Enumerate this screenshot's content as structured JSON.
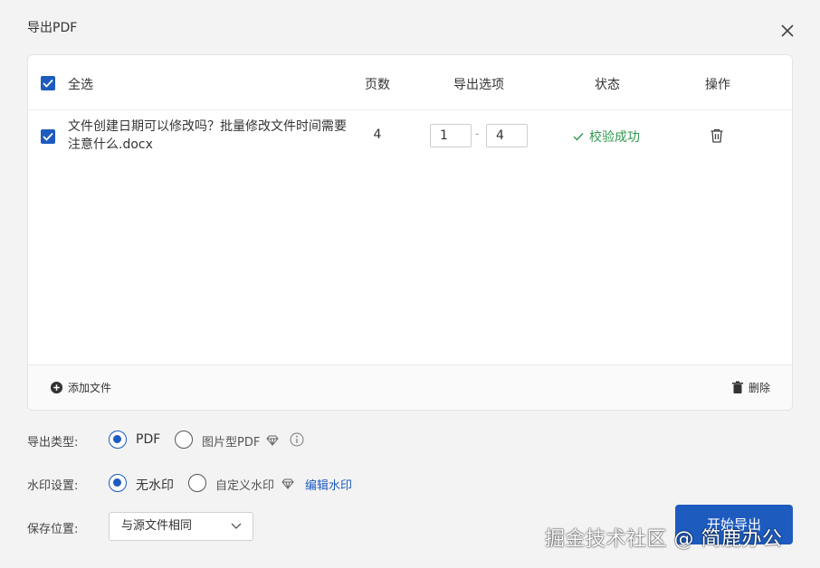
{
  "window": {
    "title": "导出PDF"
  },
  "table": {
    "headers": {
      "select_all": "全选",
      "pages": "页数",
      "export_options": "导出选项",
      "status": "状态",
      "actions": "操作"
    },
    "rows": [
      {
        "checked": true,
        "name": "文件创建日期可以修改吗？批量修改文件时间需要注意什么.docx",
        "pages": "4",
        "from": "1",
        "to": "4",
        "range_separator": "-",
        "status": "校验成功"
      }
    ],
    "footer": {
      "add_file": "添加文件",
      "delete": "删除"
    }
  },
  "export_type": {
    "label": "导出类型:",
    "options": [
      "PDF",
      "图片型PDF"
    ],
    "selected": "PDF"
  },
  "watermark": {
    "label": "水印设置:",
    "options": [
      "无水印",
      "自定义水印"
    ],
    "selected": "无水印",
    "edit_link": "编辑水印"
  },
  "save_location": {
    "label": "保存位置:",
    "value": "与源文件相同"
  },
  "start_button": "开始导出",
  "overlay_watermark": "掘金技术社区 @ 简鹿办公",
  "colors": {
    "accent": "#1d5bbf",
    "success": "#2f9a4d",
    "background": "#f3f3f3"
  }
}
